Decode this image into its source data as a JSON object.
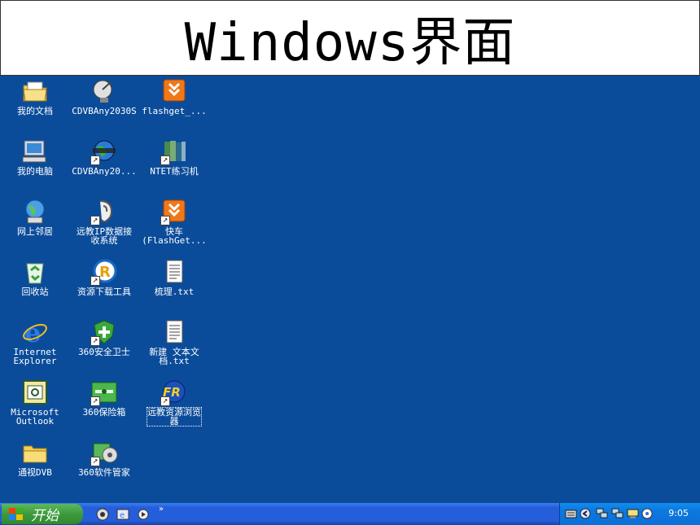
{
  "slide_title": "Windows界面",
  "desktop_icons": [
    {
      "label": "我的文档",
      "icon": "my-documents-icon",
      "shortcut": false
    },
    {
      "label": "我的电脑",
      "icon": "my-computer-icon",
      "shortcut": false
    },
    {
      "label": "网上邻居",
      "icon": "network-places-icon",
      "shortcut": false
    },
    {
      "label": "回收站",
      "icon": "recycle-bin-icon",
      "shortcut": false
    },
    {
      "label": "Internet\nExplorer",
      "icon": "internet-explorer-icon",
      "shortcut": false
    },
    {
      "label": "Microsoft\nOutlook",
      "icon": "outlook-icon",
      "shortcut": false
    },
    {
      "label": "通视DVB",
      "icon": "folder-icon",
      "shortcut": false
    },
    {
      "label": "CDVBAny2030S",
      "icon": "satellite-dish-icon",
      "shortcut": false
    },
    {
      "label": "CDVBAny20...",
      "icon": "globe-film-icon",
      "shortcut": true
    },
    {
      "label": "远教IP数据接\n收系统",
      "icon": "ear-receiver-icon",
      "shortcut": true
    },
    {
      "label": "资源下载工具",
      "icon": "r-download-icon",
      "shortcut": true
    },
    {
      "label": "360安全卫士",
      "icon": "shield-plus-icon",
      "shortcut": true
    },
    {
      "label": "360保险箱",
      "icon": "safe-box-icon",
      "shortcut": true
    },
    {
      "label": "360软件管家",
      "icon": "software-manager-icon",
      "shortcut": true
    },
    {
      "label": "flashget_...",
      "icon": "flashget-icon",
      "shortcut": false
    },
    {
      "label": "NTET练习机",
      "icon": "books-icon",
      "shortcut": true
    },
    {
      "label": "快车\n(FlashGet...",
      "icon": "flashget-icon",
      "shortcut": true
    },
    {
      "label": "梳理.txt",
      "icon": "text-file-icon",
      "shortcut": false
    },
    {
      "label": "新建 文本文\n档.txt",
      "icon": "text-file-icon",
      "shortcut": false
    },
    {
      "label": "远教资源浏览\n器",
      "icon": "fr-browser-icon",
      "shortcut": true
    }
  ],
  "taskbar": {
    "start_label": "开始",
    "quick_launch": [
      "show-desktop-icon",
      "ie-quicklaunch-icon",
      "media-icon"
    ],
    "chevron": "»",
    "tray_icons": [
      "keyboard-icon",
      "back-arrow-icon",
      "network-icon",
      "network2-icon",
      "display-icon",
      "security-icon"
    ],
    "clock": "9:05"
  },
  "colors": {
    "desktop": "#0b4c9a",
    "taskbar": "#245edb",
    "start": "#3c9a3c",
    "tray": "#0d7ae0"
  }
}
